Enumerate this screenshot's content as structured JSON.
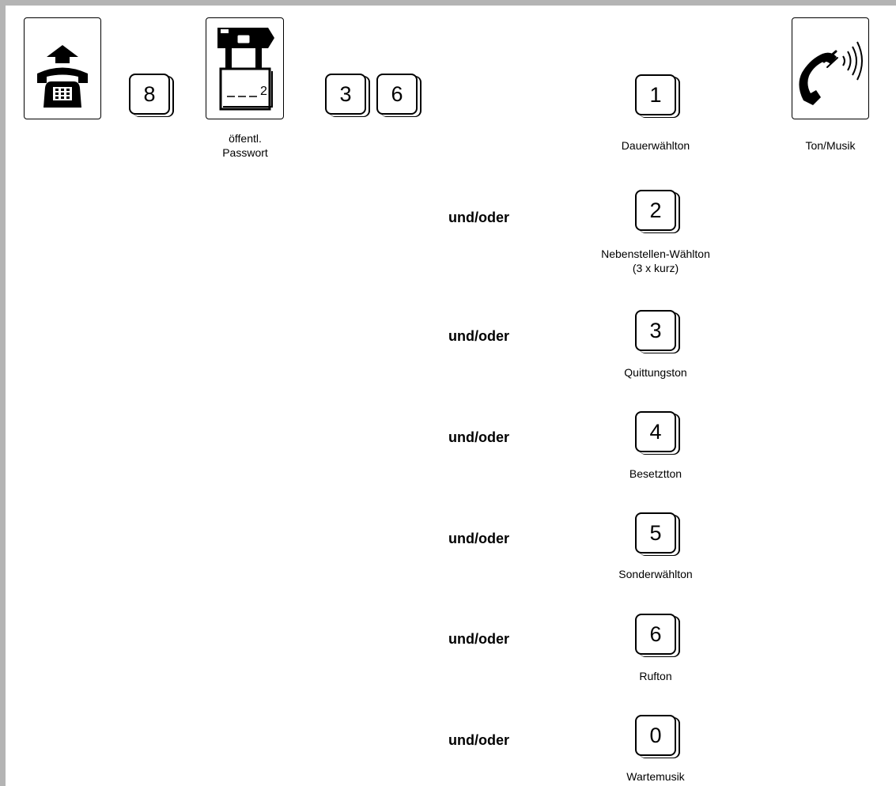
{
  "sequence": {
    "steps": [
      {
        "type": "icon",
        "icon": "handset-lift-icon"
      },
      {
        "type": "key",
        "label": "8"
      },
      {
        "type": "icon",
        "icon": "padlock-password-icon",
        "lock_digit": "2",
        "caption": "öffentl.\nPasswort"
      },
      {
        "type": "key",
        "label": "3"
      },
      {
        "type": "key",
        "label": "6"
      }
    ]
  },
  "connector": "und/oder",
  "options": [
    {
      "key": "1",
      "caption": "Dauerwählton"
    },
    {
      "key": "2",
      "caption": "Nebenstellen-Wählton\n(3 x kurz)"
    },
    {
      "key": "3",
      "caption": "Quittungston"
    },
    {
      "key": "4",
      "caption": "Besetztton"
    },
    {
      "key": "5",
      "caption": "Sonderwählton"
    },
    {
      "key": "6",
      "caption": "Rufton"
    },
    {
      "key": "0",
      "caption": "Wartemusik"
    }
  ],
  "result": {
    "icon": "handset-ringing-icon",
    "caption": "Ton/Musik"
  },
  "colors": {
    "frame": "#b4b4b4",
    "ink": "#000000",
    "paper": "#ffffff"
  }
}
